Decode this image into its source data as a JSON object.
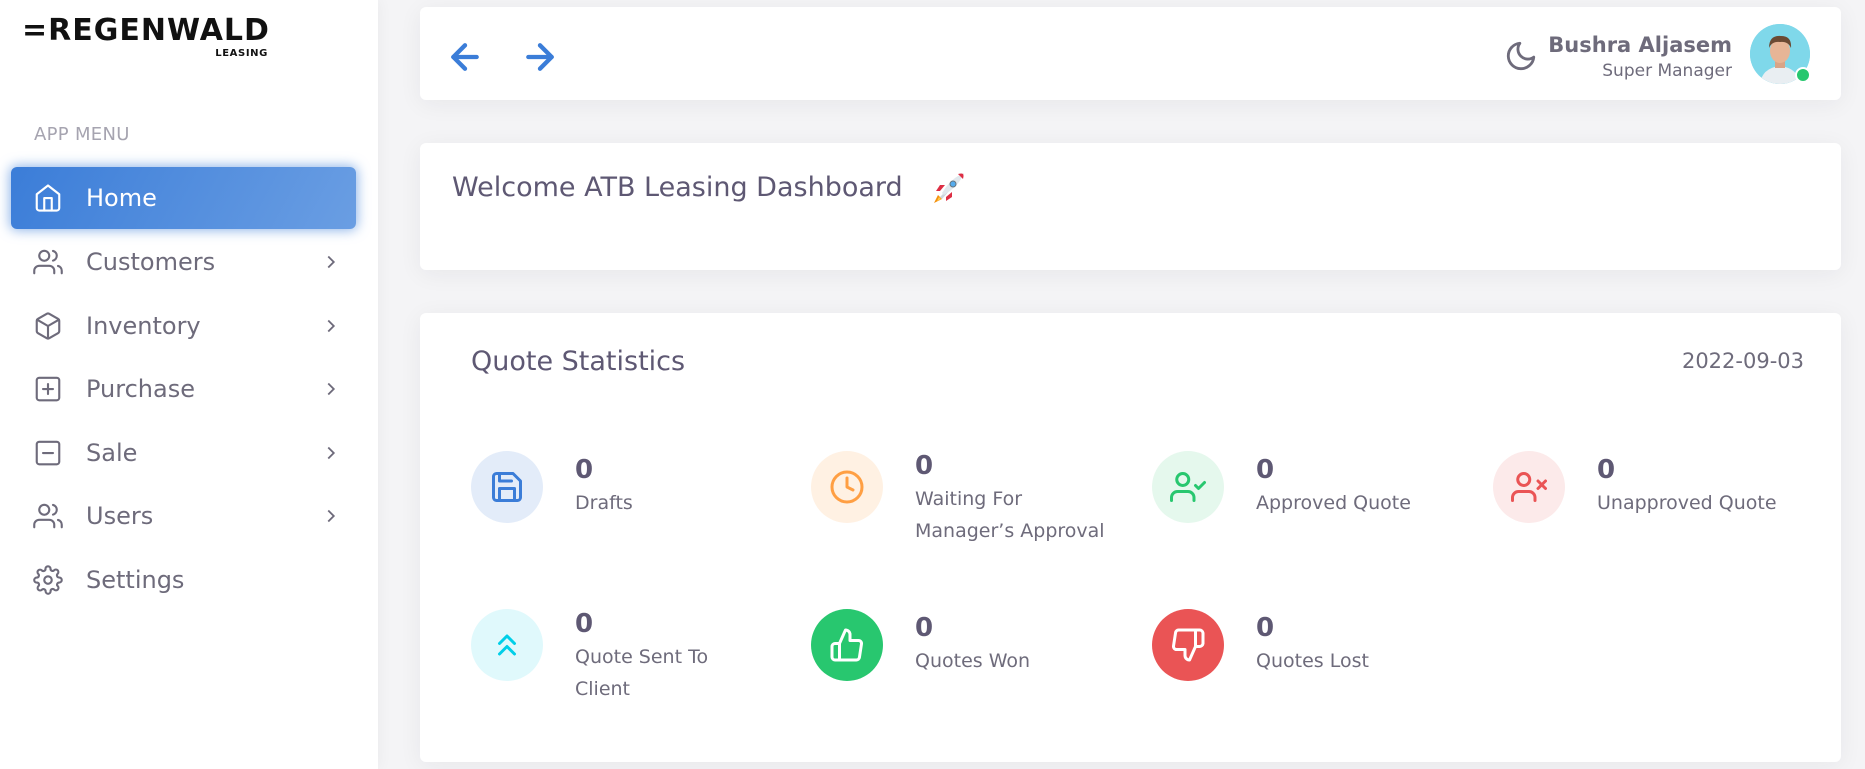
{
  "brand": {
    "name": "=REGENWALD",
    "sub": "LEASING"
  },
  "sidebar": {
    "header": "APP MENU",
    "items": [
      {
        "label": "Home",
        "icon": "home-icon",
        "active": true
      },
      {
        "label": "Customers",
        "icon": "users-icon"
      },
      {
        "label": "Inventory",
        "icon": "box-icon"
      },
      {
        "label": "Purchase",
        "icon": "plus-square-icon"
      },
      {
        "label": "Sale",
        "icon": "minus-square-icon"
      },
      {
        "label": "Users",
        "icon": "users-icon"
      },
      {
        "label": "Settings",
        "icon": "settings-icon"
      }
    ]
  },
  "navbar": {
    "user_name": "Bushra Aljasem",
    "user_role": "Super Manager",
    "status": "online"
  },
  "welcome": {
    "title": "Welcome ATB Leasing Dashboard"
  },
  "stats": {
    "title": "Quote Statistics",
    "date": "2022-09-03",
    "items": [
      {
        "value": "0",
        "label_1": "Drafts",
        "label_2": "",
        "icon": "save-icon",
        "color": "#3b7dd8",
        "bg": "#e3ecf9"
      },
      {
        "value": "0",
        "label_1": "Waiting For",
        "label_2": "Manager’s Approval",
        "icon": "clock-icon",
        "color": "#ff9f43",
        "bg": "#fff1e3"
      },
      {
        "value": "0",
        "label_1": "Approved Quote",
        "label_2": "",
        "icon": "user-check-icon",
        "color": "#28c76f",
        "bg": "#e5f8ed"
      },
      {
        "value": "0",
        "label_1": "Unapproved Quote",
        "label_2": "",
        "icon": "user-x-icon",
        "color": "#ea5455",
        "bg": "#fceaea"
      },
      {
        "value": "0",
        "label_1": "Quote Sent To",
        "label_2": "Client",
        "icon": "chevrons-up-icon",
        "color": "#00cfe8",
        "bg": "#e0f9fc"
      },
      {
        "value": "0",
        "label_1": "Quotes Won",
        "label_2": "",
        "icon": "thumbs-up-icon",
        "color": "#ffffff",
        "bg": "#28c76f"
      },
      {
        "value": "0",
        "label_1": "Quotes Lost",
        "label_2": "",
        "icon": "thumbs-down-icon",
        "color": "#ffffff",
        "bg": "#ea5455"
      }
    ]
  }
}
